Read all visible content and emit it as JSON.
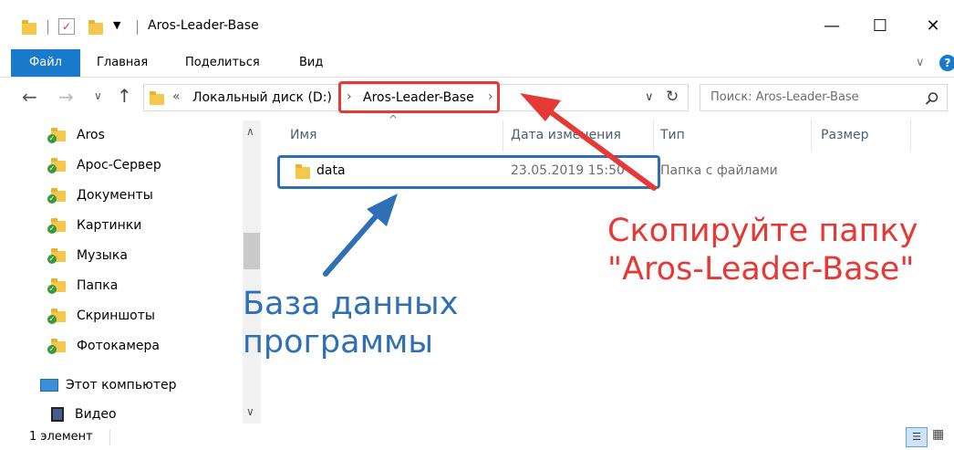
{
  "window": {
    "title": "Aros-Leader-Base",
    "minimize_glyph": "—",
    "maximize_glyph": "☐",
    "close_glyph": "✕"
  },
  "ribbon": {
    "tabs": [
      "Файл",
      "Главная",
      "Поделиться",
      "Вид"
    ],
    "expand_glyph": "∨",
    "help_glyph": "?"
  },
  "navigation": {
    "back_glyph": "←",
    "forward_glyph": "→",
    "recent_glyph": "∨",
    "up_glyph": "↑"
  },
  "address": {
    "overflow": "«",
    "crumbs": [
      "Локальный диск (D:)",
      "Aros-Leader-Base"
    ],
    "sep": "›",
    "dropdown_glyph": "∨",
    "refresh_glyph": "↻"
  },
  "search": {
    "placeholder": "Поиск: Aros-Leader-Base"
  },
  "nav_items": [
    {
      "label": "Aros",
      "icon": "folder-synced-icon"
    },
    {
      "label": "Арос-Сервер",
      "icon": "folder-synced-icon"
    },
    {
      "label": "Документы",
      "icon": "folder-synced-icon"
    },
    {
      "label": "Картинки",
      "icon": "folder-synced-icon"
    },
    {
      "label": "Музыка",
      "icon": "folder-synced-icon"
    },
    {
      "label": "Папка",
      "icon": "folder-synced-icon"
    },
    {
      "label": "Скриншоты",
      "icon": "folder-synced-icon"
    },
    {
      "label": "Фотокамера",
      "icon": "folder-synced-icon"
    },
    {
      "label": "Этот компьютер",
      "icon": "computer-icon"
    },
    {
      "label": "Видео",
      "icon": "video-icon"
    }
  ],
  "columns": [
    "Имя",
    "Дата изменения",
    "Тип",
    "Размер"
  ],
  "files": [
    {
      "name": "data",
      "modified": "23.05.2019 15:50",
      "type": "Папка с файлами",
      "size": ""
    }
  ],
  "status": {
    "count": "1 элемент"
  },
  "annotations": {
    "red_line1": "Скопируйте папку",
    "red_line2": "\"Aros-Leader-Base\"",
    "blue_line1": "База данных",
    "blue_line2": "программы",
    "red_color": "#e53935",
    "blue_color": "#2f6fb5"
  }
}
